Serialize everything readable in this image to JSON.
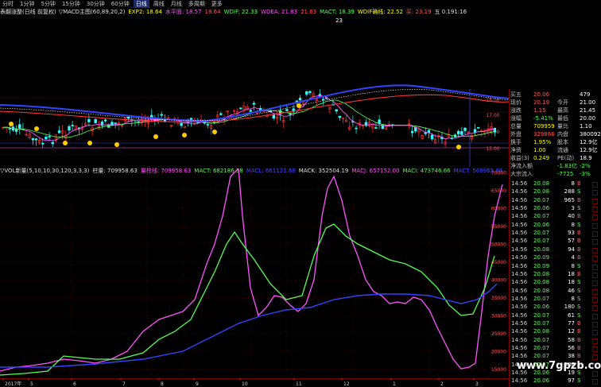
{
  "toolbar": {
    "items": [
      "分时",
      "1分钟",
      "5分钟",
      "15分钟",
      "30分钟",
      "60分钟",
      "日线",
      "周线",
      "月线",
      "多周期",
      "更多"
    ],
    "active_index": 6
  },
  "price_header": {
    "name": "表翻涨整(日线 前复权)",
    "items": [
      {
        "t": "▽MACD主图(60,89,20,2)",
        "c": "#e0e0e0"
      },
      {
        "t": "EXP2: 18.64",
        "c": "#ffff00"
      },
      {
        "t": "水平面: 18.57",
        "c": "#ff55ff"
      },
      {
        "t": "18.64",
        "c": "#ff5555"
      },
      {
        "t": "WDIF: 22.33",
        "c": "#55ff55"
      },
      {
        "t": "WDEA: 21.83",
        "c": "#ff55ff"
      },
      {
        "t": "21.63",
        "c": "#ff5555"
      },
      {
        "t": "MACT: 18.39",
        "c": "#55ff55"
      },
      {
        "t": "WDIF确线: 22.52",
        "c": "#ffff00"
      },
      {
        "t": "买: 23.19",
        "c": "#ff5555"
      },
      {
        "t": "五 0.191:16",
        "c": "#e0e0e0"
      }
    ],
    "annotation": "23"
  },
  "price_axis": {
    "ticks": [
      "18.00",
      "17.00",
      "16.00",
      "15.00"
    ],
    "labels_inline": [
      "下",
      "大",
      "D",
      "大",
      "卖",
      "下"
    ]
  },
  "vol_header": {
    "items": [
      {
        "t": "▽VOL新量(5,10,10,30,120,3,3,3)",
        "c": "#e0e0e0"
      },
      {
        "t": "柱量: 709958.63",
        "c": "#e0e0e0"
      },
      {
        "t": "量柱线: 709958.63",
        "c": "#ff55ff"
      },
      {
        "t": "MACT: 682186.38",
        "c": "#55ff55"
      },
      {
        "t": "MACL: 661121.88",
        "c": "#4444ff"
      },
      {
        "t": "MACK: 352504.19",
        "c": "#e0e0e0"
      },
      {
        "t": "MACJ: 657152.00",
        "c": "#ff55ff"
      },
      {
        "t": "MACI: 473746.66",
        "c": "#55ff55"
      },
      {
        "t": "MACT: 569963.88",
        "c": "#4444ff"
      }
    ]
  },
  "vol_axis": {
    "ticks": [
      "70000",
      "65000",
      "60000",
      "55000",
      "50000",
      "45000",
      "40000",
      "35000",
      "30000",
      "25000",
      "20000",
      "15000"
    ]
  },
  "xaxis": {
    "labels": [
      "2017年",
      "5",
      "6",
      "7",
      "8",
      "9",
      "10",
      "11",
      "12",
      "1",
      "2",
      "3"
    ]
  },
  "quote": {
    "rows": [
      {
        "l": "买五",
        "v": "20.06",
        "v2": "",
        "v3": "479",
        "vc": "#ff5555"
      },
      {
        "l": "现价",
        "v": "20.19",
        "v2": "今开",
        "v3": "21.00",
        "vc": "#ff5555"
      },
      {
        "l": "涨跌",
        "v": "1.15",
        "v2": "最高",
        "v3": "21.45",
        "vc": "#ff5555"
      },
      {
        "l": "涨幅",
        "v": "-5.41%",
        "v2": "最低",
        "v3": "20.00",
        "vc": "#55ff55"
      },
      {
        "l": "总量",
        "v": "709959",
        "v2": "量比",
        "v3": "1.10",
        "vc": "#ffff00"
      },
      {
        "l": "外盘",
        "v": "329866",
        "v2": "内盘",
        "v3": "380092",
        "vc": "#ff5555"
      },
      {
        "l": "换手",
        "v": "1.95%",
        "v2": "股本",
        "v3": "12.9亿",
        "vc": "#ffff00"
      },
      {
        "l": "净资",
        "v": "1.00",
        "v2": "流通",
        "v3": "12.9亿",
        "vc": "#ffff00"
      },
      {
        "l": "收益(3)",
        "v": "0.249",
        "v2": "PE(动)",
        "v3": "18.9",
        "vc": "#ffff00"
      },
      {
        "l": "净流入额",
        "v": "",
        "v2": "-1.83亿",
        "v3": "-2%",
        "vc": "#55ff55"
      },
      {
        "l": "大宗流入",
        "v": "",
        "v2": "-7725",
        "v3": "-3%",
        "vc": "#55ff55"
      }
    ]
  },
  "ticks": {
    "rows": [
      {
        "t": "14:56",
        "p": "20.08",
        "v": "8",
        "s": "B"
      },
      {
        "t": "14:56",
        "p": "20.08",
        "v": "288",
        "s": "S"
      },
      {
        "t": "14:56",
        "p": "20.07",
        "v": "965",
        "s": "B"
      },
      {
        "t": "14:56",
        "p": "20.06",
        "v": "3",
        "s": "S"
      },
      {
        "t": "14:56",
        "p": "20.07",
        "v": "40",
        "s": "B"
      },
      {
        "t": "14:56",
        "p": "20.06",
        "v": "8",
        "s": "S"
      },
      {
        "t": "14:56",
        "p": "20.07",
        "v": "93",
        "s": "B"
      },
      {
        "t": "14:56",
        "p": "20.07",
        "v": "57",
        "s": "B"
      },
      {
        "t": "14:56",
        "p": "20.08",
        "v": "94",
        "s": "B"
      },
      {
        "t": "14:56",
        "p": "20.09",
        "v": "4",
        "s": "B"
      },
      {
        "t": "14:56",
        "p": "20.09",
        "v": "8",
        "s": "S"
      },
      {
        "t": "14:56",
        "p": "20.08",
        "v": "18",
        "s": "B"
      },
      {
        "t": "14:56",
        "p": "20.08",
        "v": "18",
        "s": "S"
      },
      {
        "t": "14:56",
        "p": "20.08",
        "v": "46",
        "s": "S"
      },
      {
        "t": "14:56",
        "p": "20.07",
        "v": "8",
        "s": "S"
      },
      {
        "t": "14:56",
        "p": "20.06",
        "v": "180",
        "s": "S"
      },
      {
        "t": "14:56",
        "p": "20.07",
        "v": "61",
        "s": "S"
      },
      {
        "t": "14:56",
        "p": "20.07",
        "v": "77",
        "s": "B"
      },
      {
        "t": "14:56",
        "p": "20.08",
        "v": "12",
        "s": "B"
      },
      {
        "t": "14:56",
        "p": "20.07",
        "v": "58",
        "s": "B"
      },
      {
        "t": "14:56",
        "p": "20.07",
        "v": "56",
        "s": "B"
      },
      {
        "t": "14:56",
        "p": "20.07",
        "v": "38",
        "s": "B"
      },
      {
        "t": "14:56",
        "p": "20.07",
        "v": "586",
        "s": "B"
      },
      {
        "t": "14:56",
        "p": "20.06",
        "v": "19",
        "s": "S"
      },
      {
        "t": "14:56",
        "p": "20.06",
        "v": "97",
        "s": "S"
      }
    ]
  },
  "watermark": "www.7gpzb.com",
  "colors": {
    "up": "#ff3333",
    "down": "#33ffff",
    "ma_magenta": "#ff55ff",
    "ma_green": "#55ff55",
    "ma_blue": "#4444ff",
    "grid": "#7a0000"
  }
}
